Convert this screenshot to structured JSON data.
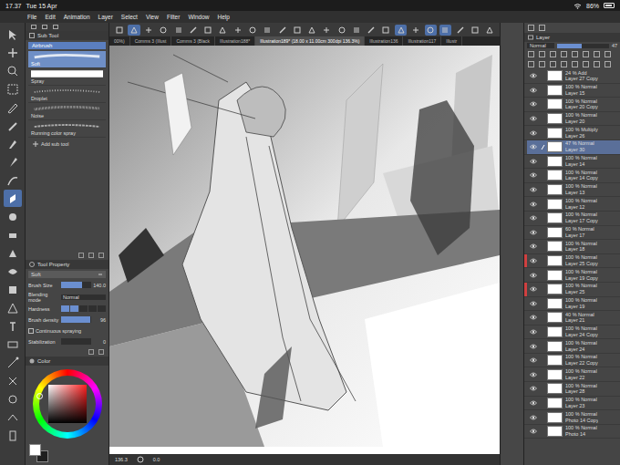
{
  "status_bar": {
    "time": "17.37",
    "date": "Tue 15 Apr",
    "battery": "86%",
    "battery_level": 0.86
  },
  "menu": [
    "File",
    "Edit",
    "Animation",
    "Layer",
    "Select",
    "View",
    "Filter",
    "Window",
    "Help"
  ],
  "tools": [
    {
      "selected": false
    },
    {
      "selected": false
    },
    {
      "selected": false
    },
    {
      "selected": false
    },
    {
      "selected": false
    },
    {
      "selected": false
    },
    {
      "selected": false
    },
    {
      "selected": false
    },
    {
      "selected": false
    },
    {
      "selected": true
    },
    {
      "selected": false
    },
    {
      "selected": false
    },
    {
      "selected": false
    },
    {
      "selected": false
    },
    {
      "selected": false
    },
    {
      "selected": false
    },
    {
      "selected": false
    },
    {
      "selected": false
    },
    {
      "selected": false
    },
    {
      "selected": false
    },
    {
      "selected": false
    },
    {
      "selected": false
    },
    {
      "selected": false
    }
  ],
  "sub_tool": {
    "title": "Sub Tool",
    "group": "Airbrush",
    "items": [
      {
        "label": "Soft",
        "selected": true
      },
      {
        "label": "Spray",
        "selected": false
      },
      {
        "label": "Droplet",
        "selected": false
      },
      {
        "label": "Noise",
        "selected": false
      },
      {
        "label": "Running color spray",
        "selected": false
      }
    ],
    "add": "Add sub tool"
  },
  "tool_property": {
    "title": "Tool Property",
    "preset": "Soft",
    "rows": [
      {
        "kind": "slider",
        "label": "Brush Size",
        "value": "140.0",
        "level": 0.7
      },
      {
        "kind": "select",
        "label": "Blending mode",
        "value": "Normal"
      },
      {
        "kind": "steps",
        "label": "Hardness",
        "level": 0.4
      },
      {
        "kind": "slider",
        "label": "Brush density",
        "value": "96",
        "level": 0.96
      },
      {
        "kind": "checkbox",
        "label": "Continuous spraying",
        "checked": false
      },
      {
        "kind": "slider",
        "label": "Stabilization",
        "value": "0",
        "level": 0
      }
    ]
  },
  "color": {
    "title": "Color",
    "hue": "#ff2020",
    "main": "#ffffff",
    "sub": "#1e1e1e"
  },
  "command_bar": [
    {
      "on": false
    },
    {
      "on": true
    },
    {
      "on": false
    },
    {
      "on": false
    },
    {
      "on": false
    },
    {
      "on": false
    },
    {
      "on": false
    },
    {
      "on": false
    },
    {
      "on": false
    },
    {
      "on": false
    },
    {
      "on": false
    },
    {
      "on": false
    },
    {
      "on": false
    },
    {
      "on": false
    },
    {
      "on": false
    },
    {
      "on": false
    },
    {
      "on": false
    },
    {
      "on": false
    },
    {
      "on": false
    },
    {
      "on": true
    },
    {
      "on": false
    },
    {
      "on": true
    },
    {
      "on": true
    },
    {
      "on": false
    },
    {
      "on": false
    },
    {
      "on": false
    }
  ],
  "document_tabs": [
    {
      "label": "00%)",
      "selected": false
    },
    {
      "label": "Comms 3 (Illust",
      "selected": false
    },
    {
      "label": "Comms 3 (Black",
      "selected": false
    },
    {
      "label": "Illustration188*",
      "selected": false
    },
    {
      "label": "Illustration189* (18.00 x 11.00cm 300dpi 136.3%)",
      "selected": true
    },
    {
      "label": "Illustration136",
      "selected": false
    },
    {
      "label": "Illustration117",
      "selected": false
    },
    {
      "label": "Illustr",
      "selected": false
    }
  ],
  "canvas": {
    "zoom": "136.3",
    "angle": "0.0"
  },
  "layers": {
    "title": "Layer",
    "blend": "Normal",
    "opacity": "47",
    "opacity_level": 0.47,
    "items": [
      {
        "opacity": "24 %",
        "mode": "Add",
        "name": "Layer 27 Copy",
        "visible": true,
        "selected": false,
        "color": "#454545"
      },
      {
        "opacity": "100 %",
        "mode": "Normal",
        "name": "Layer 15",
        "visible": true,
        "selected": false,
        "color": "#454545"
      },
      {
        "opacity": "100 %",
        "mode": "Normal",
        "name": "Layer 20 Copy",
        "visible": true,
        "selected": false,
        "color": "#454545"
      },
      {
        "opacity": "100 %",
        "mode": "Normal",
        "name": "Layer 20",
        "visible": true,
        "selected": false,
        "color": "#454545"
      },
      {
        "opacity": "100 %",
        "mode": "Multiply",
        "name": "Layer 26",
        "visible": true,
        "selected": false,
        "color": "#454545"
      },
      {
        "opacity": "47 %",
        "mode": "Normal",
        "name": "Layer 30",
        "visible": true,
        "selected": true,
        "color": "#454545"
      },
      {
        "opacity": "100 %",
        "mode": "Normal",
        "name": "Layer 14",
        "visible": true,
        "selected": false,
        "color": "#454545"
      },
      {
        "opacity": "100 %",
        "mode": "Normal",
        "name": "Layer 14 Copy",
        "visible": true,
        "selected": false,
        "color": "#454545"
      },
      {
        "opacity": "100 %",
        "mode": "Normal",
        "name": "Layer 13",
        "visible": true,
        "selected": false,
        "color": "#454545"
      },
      {
        "opacity": "100 %",
        "mode": "Normal",
        "name": "Layer 12",
        "visible": true,
        "selected": false,
        "color": "#454545"
      },
      {
        "opacity": "100 %",
        "mode": "Normal",
        "name": "Layer 17 Copy",
        "visible": true,
        "selected": false,
        "color": "#454545"
      },
      {
        "opacity": "60 %",
        "mode": "Normal",
        "name": "Layer 17",
        "visible": true,
        "selected": false,
        "color": "#454545"
      },
      {
        "opacity": "100 %",
        "mode": "Normal",
        "name": "Layer 18",
        "visible": true,
        "selected": false,
        "color": "#454545"
      },
      {
        "opacity": "100 %",
        "mode": "Normal",
        "name": "Layer 25 Copy",
        "visible": true,
        "selected": false,
        "color": "#d04040"
      },
      {
        "opacity": "100 %",
        "mode": "Normal",
        "name": "Layer 19 Copy",
        "visible": true,
        "selected": false,
        "color": "#454545"
      },
      {
        "opacity": "100 %",
        "mode": "Normal",
        "name": "Layer 25",
        "visible": true,
        "selected": false,
        "color": "#d04040"
      },
      {
        "opacity": "100 %",
        "mode": "Normal",
        "name": "Layer 19",
        "visible": true,
        "selected": false,
        "color": "#454545"
      },
      {
        "opacity": "40 %",
        "mode": "Normal",
        "name": "Layer 21",
        "visible": true,
        "selected": false,
        "color": "#454545"
      },
      {
        "opacity": "100 %",
        "mode": "Normal",
        "name": "Layer 24 Copy",
        "visible": true,
        "selected": false,
        "color": "#454545"
      },
      {
        "opacity": "100 %",
        "mode": "Normal",
        "name": "Layer 24",
        "visible": true,
        "selected": false,
        "color": "#454545"
      },
      {
        "opacity": "100 %",
        "mode": "Normal",
        "name": "Layer 22 Copy",
        "visible": true,
        "selected": false,
        "color": "#454545"
      },
      {
        "opacity": "100 %",
        "mode": "Normal",
        "name": "Layer 22",
        "visible": true,
        "selected": false,
        "color": "#454545"
      },
      {
        "opacity": "100 %",
        "mode": "Normal",
        "name": "Layer 28",
        "visible": true,
        "selected": false,
        "color": "#454545"
      },
      {
        "opacity": "100 %",
        "mode": "Normal",
        "name": "Layer 23",
        "visible": true,
        "selected": false,
        "color": "#454545"
      },
      {
        "opacity": "100 %",
        "mode": "Normal",
        "name": "Photo 14 Copy",
        "visible": true,
        "selected": false,
        "color": "#454545"
      },
      {
        "opacity": "100 %",
        "mode": "Normal",
        "name": "Photo 14",
        "visible": true,
        "selected": false,
        "color": "#454545"
      }
    ]
  }
}
